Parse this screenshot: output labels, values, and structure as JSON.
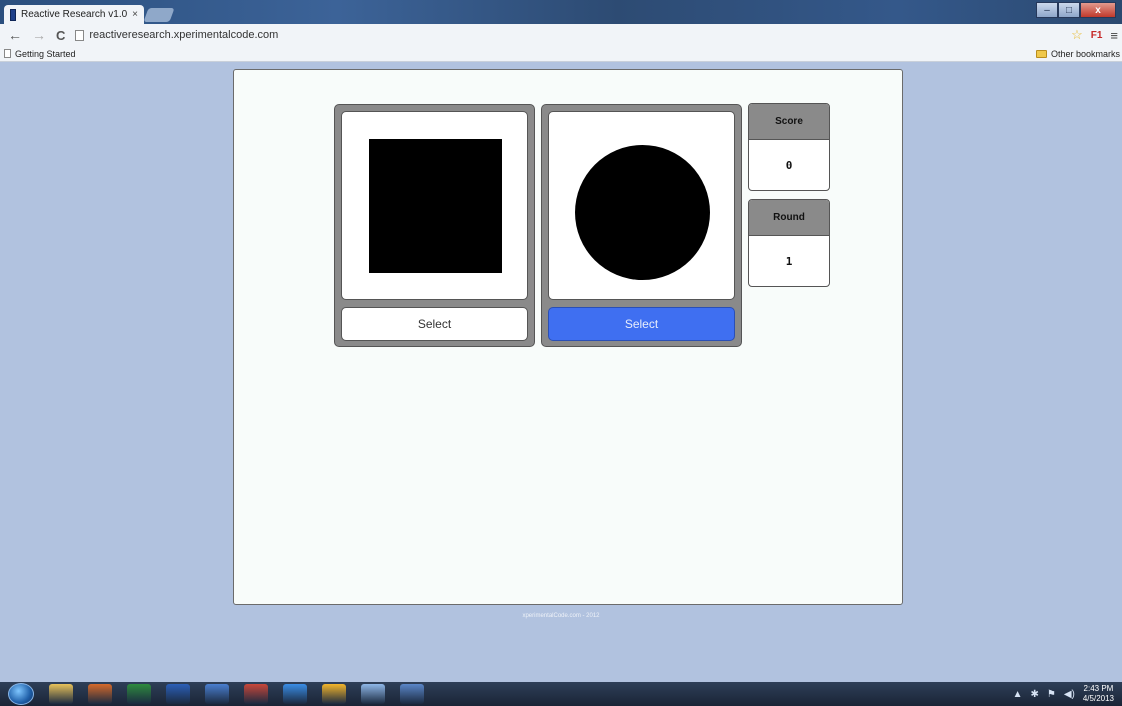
{
  "browser": {
    "tab_title": "Reactive Research v1.0",
    "tab_close": "×",
    "url": "reactiveresearch.xperimentalcode.com",
    "bookmark_getting_started": "Getting Started",
    "bookmark_other": "Other bookmarks",
    "ext_label": "F1",
    "window_min": "–",
    "window_max": "□",
    "window_close": "x"
  },
  "game": {
    "cards": [
      {
        "shape": "square",
        "button_label": "Select",
        "selected": false
      },
      {
        "shape": "circle",
        "button_label": "Select",
        "selected": true
      }
    ],
    "score_label": "Score",
    "score_value": "0",
    "round_label": "Round",
    "round_value": "1"
  },
  "footer": {
    "text": "xperimentalCode.com - 2012"
  },
  "taskbar": {
    "time": "2:43 PM",
    "date": "4/5/2013",
    "apps": [
      {
        "name": "explorer-icon",
        "color": "#e8c25a"
      },
      {
        "name": "outlook-icon",
        "color": "#d66a2b"
      },
      {
        "name": "excel-icon",
        "color": "#2e8b3e"
      },
      {
        "name": "word-icon",
        "color": "#2b5fb8"
      },
      {
        "name": "app-icon",
        "color": "#4a7fd0"
      },
      {
        "name": "paint-icon",
        "color": "#c9473a"
      },
      {
        "name": "ie-icon",
        "color": "#3a8ee6"
      },
      {
        "name": "chrome-icon",
        "color": "#f3b52b"
      },
      {
        "name": "calculator-icon",
        "color": "#8fb7e8"
      },
      {
        "name": "tool-icon",
        "color": "#5a86c8"
      }
    ]
  },
  "colors": {
    "page_background": "#b1c2df",
    "select_active": "#3f6ff1",
    "card_frame": "#8a8a8a"
  }
}
